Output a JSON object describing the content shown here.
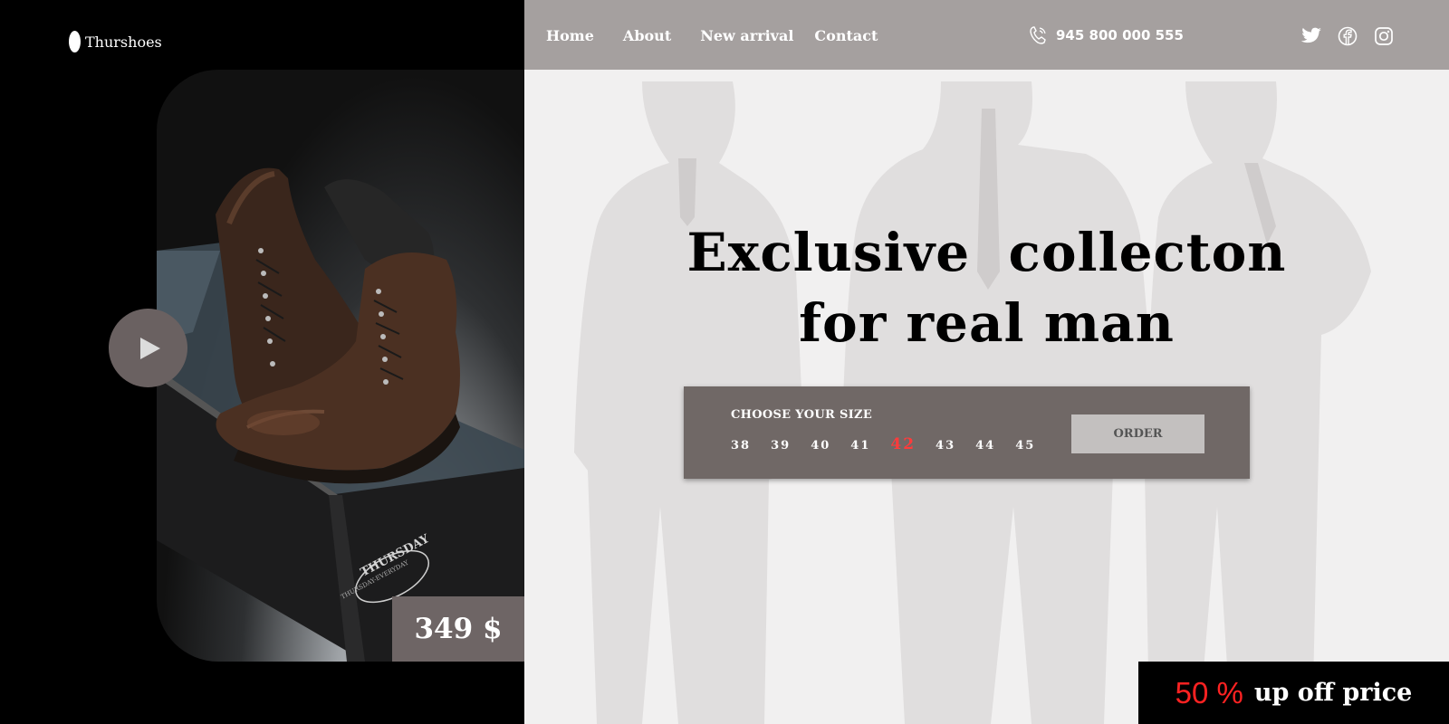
{
  "brand": {
    "name": "Thurshoes"
  },
  "nav": {
    "items": [
      "Home",
      "About",
      "New arrival",
      "Contact"
    ]
  },
  "contact": {
    "phone": "945 800 000 555",
    "icon": "phone-icon"
  },
  "socials": [
    "twitter-icon",
    "facebook-icon",
    "instagram-icon"
  ],
  "hero": {
    "headline_lines": [
      "Exclusive  collecton",
      "for real man"
    ]
  },
  "size_picker": {
    "label": "CHOOSE YOUR SIZE",
    "sizes": [
      "38",
      "39",
      "40",
      "41",
      "42",
      "43",
      "44",
      "45"
    ],
    "selected": "42",
    "order_label": "ORDER"
  },
  "product": {
    "price": "349 $",
    "box_brand": "THURSDAY",
    "box_tagline": "THURSDAY-EVERYDAY"
  },
  "promo": {
    "percent": "50 %",
    "text": "up off price"
  },
  "colors": {
    "topbar": "#a5a09f",
    "panel": "#706866",
    "accent_red": "#ff3b3b",
    "background": "#f1f0f0"
  }
}
